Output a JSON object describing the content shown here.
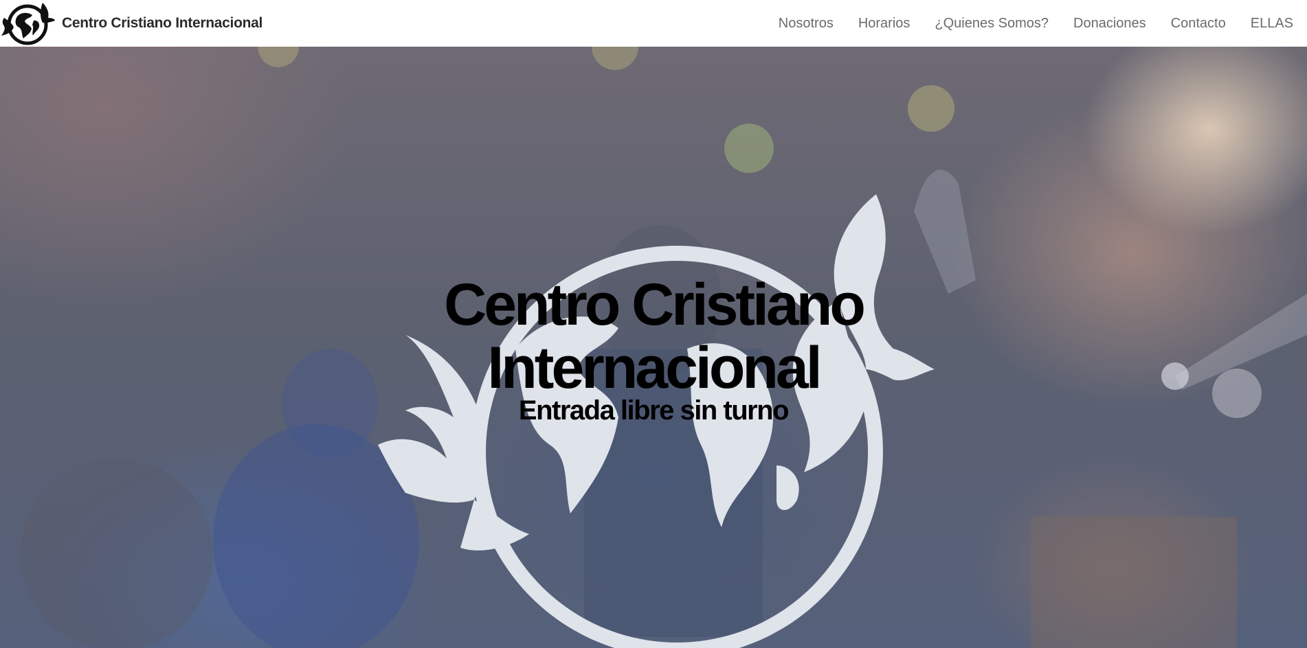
{
  "brand": {
    "name": "Centro Cristiano Internacional",
    "logo_icon": "dove-globe-logo-icon"
  },
  "nav": {
    "items": [
      {
        "label": "Nosotros"
      },
      {
        "label": "Horarios"
      },
      {
        "label": "¿Quienes Somos?"
      },
      {
        "label": "Donaciones"
      },
      {
        "label": "Contacto"
      },
      {
        "label": "ELLAS"
      }
    ]
  },
  "hero": {
    "title_line1": "Centro Cristiano",
    "title_line2": "Internacional",
    "subtitle": "Entrada libre sin turno",
    "emblem_icon": "dove-globe-emblem-icon"
  },
  "colors": {
    "navbar_bg": "#ffffff",
    "nav_text": "#6b6b6b",
    "brand_text": "#2b2b2b",
    "emblem_fill": "#dfe3ea",
    "hero_text": "#000000"
  }
}
